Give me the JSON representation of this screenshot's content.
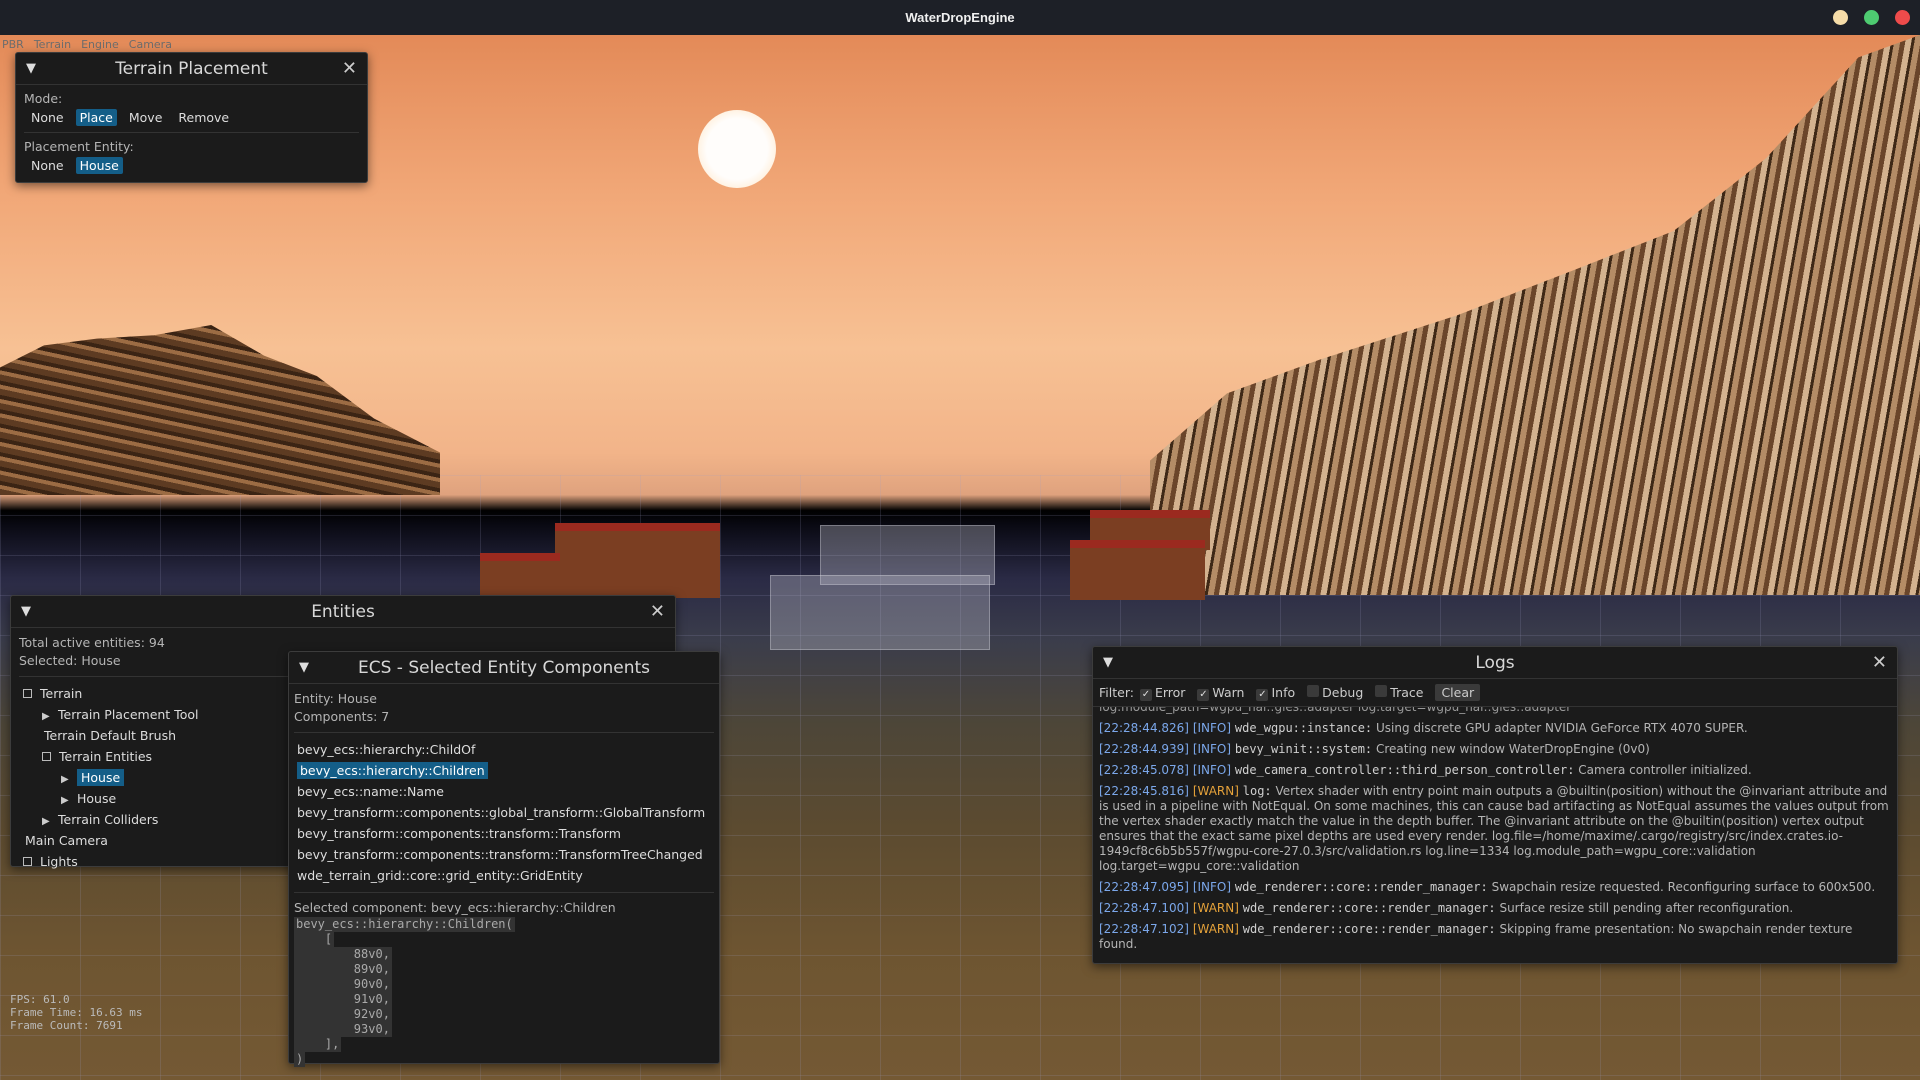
{
  "app": {
    "title": "WaterDropEngine"
  },
  "window_controls": {
    "colors": [
      "#f5dca8",
      "#4ecb71",
      "#ee4b4b"
    ]
  },
  "menu": [
    "PBR",
    "Terrain",
    "Engine",
    "Camera"
  ],
  "stats": {
    "fps": "FPS: 61.0",
    "frame_time": "Frame Time: 16.63 ms",
    "frame_count": "Frame Count: 7691"
  },
  "terrain_placement": {
    "title": "Terrain Placement",
    "mode_label": "Mode:",
    "modes": [
      "None",
      "Place",
      "Move",
      "Remove"
    ],
    "selected_mode": "Place",
    "entity_label": "Placement Entity:",
    "entities": [
      "None",
      "House"
    ],
    "selected_entity": "House"
  },
  "entities_panel": {
    "title": "Entities",
    "total": "Total active entities: 94",
    "selected": "Selected: House",
    "tree": [
      {
        "label": "Terrain",
        "icon": "square",
        "indent": 0
      },
      {
        "label": "Terrain Placement Tool",
        "icon": "arrow",
        "indent": 1
      },
      {
        "label": "Terrain Default Brush",
        "icon": "none",
        "indent": 1
      },
      {
        "label": "Terrain Entities",
        "icon": "square",
        "indent": 1
      },
      {
        "label": "House",
        "icon": "arrow",
        "indent": 2,
        "selected": true
      },
      {
        "label": "House",
        "icon": "arrow",
        "indent": 2
      },
      {
        "label": "Terrain Colliders",
        "icon": "arrow",
        "indent": 1
      },
      {
        "label": "Main Camera",
        "icon": "none",
        "indent": 0
      },
      {
        "label": "Lights",
        "icon": "square",
        "indent": 0
      }
    ]
  },
  "ecs_panel": {
    "title": "ECS - Selected Entity Components",
    "entity": "Entity: House",
    "components_count": "Components: 7",
    "components": [
      "bevy_ecs::hierarchy::ChildOf",
      "bevy_ecs::hierarchy::Children",
      "bevy_ecs::name::Name",
      "bevy_transform::components::global_transform::GlobalTransform",
      "bevy_transform::components::transform::Transform",
      "bevy_transform::components::transform::TransformTreeChanged",
      "wde_terrain_grid::core::grid_entity::GridEntity"
    ],
    "selected_index": 1,
    "selected_component": "Selected component: bevy_ecs::hierarchy::Children",
    "code_lines": [
      "bevy_ecs::hierarchy::Children(",
      "    [",
      "        88v0,",
      "        89v0,",
      "        90v0,",
      "        91v0,",
      "        92v0,",
      "        93v0,",
      "    ],",
      ")"
    ]
  },
  "logs_panel": {
    "title": "Logs",
    "filter_label": "Filter:",
    "filters": [
      {
        "label": "Error",
        "checked": true
      },
      {
        "label": "Warn",
        "checked": true
      },
      {
        "label": "Info",
        "checked": true
      },
      {
        "label": "Debug",
        "checked": false
      },
      {
        "label": "Trace",
        "checked": false
      }
    ],
    "clear_label": "Clear",
    "partial_line": "log.module_path=wgpu_hal::gles::adapter log.target=wgpu_hal::gles::adapter",
    "entries": [
      {
        "ts": "[22:28:44.826]",
        "level": "[INFO]",
        "target": "wde_wgpu::instance:",
        "msg": "Using discrete GPU adapter NVIDIA GeForce RTX 4070 SUPER."
      },
      {
        "ts": "[22:28:44.939]",
        "level": "[INFO]",
        "target": "bevy_winit::system:",
        "msg": "Creating new window WaterDropEngine (0v0)"
      },
      {
        "ts": "[22:28:45.078]",
        "level": "[INFO]",
        "target": "wde_camera_controller::third_person_controller:",
        "msg": "Camera controller initialized."
      },
      {
        "ts": "[22:28:45.816]",
        "level": "[WARN]",
        "target": "log:",
        "msg": "Vertex shader with entry point main outputs a @builtin(position) without the @invariant attribute and is used in a pipeline with NotEqual. On some machines, this can cause bad artifacting as NotEqual assumes the values output from the vertex shader exactly match the value in the depth buffer. The @invariant attribute on the @builtin(position) vertex output ensures that the exact same pixel depths are used every render. log.file=/home/maxime/.cargo/registry/src/index.crates.io-1949cf8c6b5b557f/wgpu-core-27.0.3/src/validation.rs log.line=1334 log.module_path=wgpu_core::validation log.target=wgpu_core::validation"
      },
      {
        "ts": "[22:28:47.095]",
        "level": "[INFO]",
        "target": "wde_renderer::core::render_manager:",
        "msg": "Swapchain resize requested. Reconfiguring surface to 600x500."
      },
      {
        "ts": "[22:28:47.100]",
        "level": "[WARN]",
        "target": "wde_renderer::core::render_manager:",
        "msg": "Surface resize still pending after reconfiguration."
      },
      {
        "ts": "[22:28:47.102]",
        "level": "[WARN]",
        "target": "wde_renderer::core::render_manager:",
        "msg": "Skipping frame presentation: No swapchain render texture found."
      }
    ]
  }
}
